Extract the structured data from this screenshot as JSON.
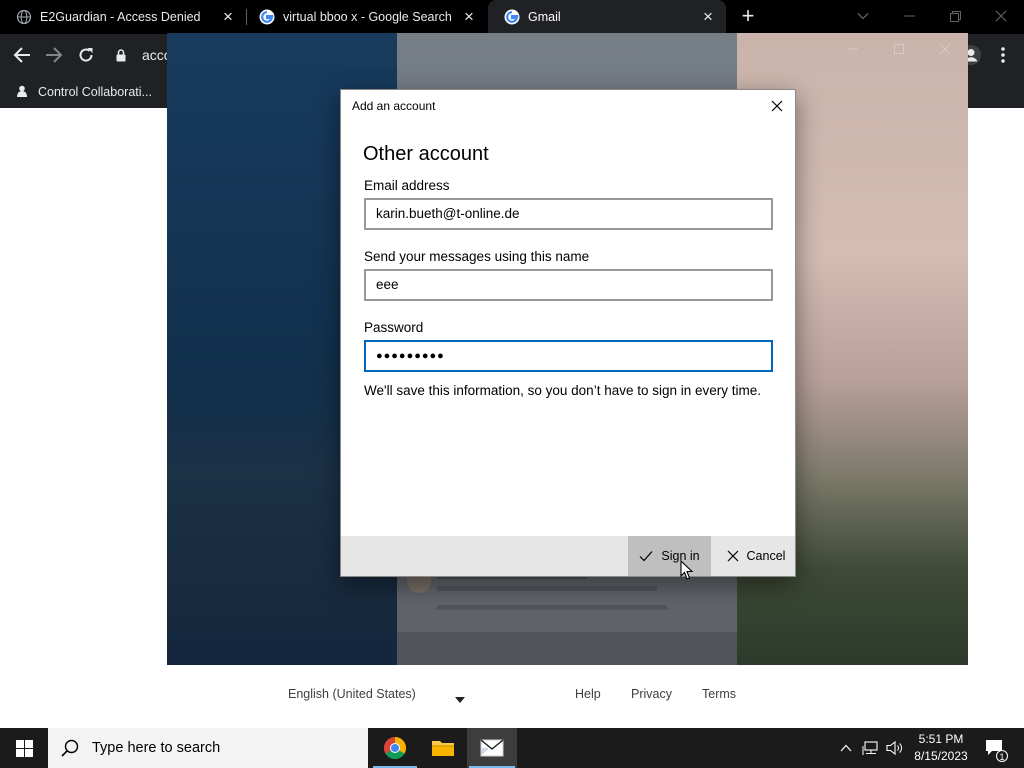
{
  "browser": {
    "tabs": [
      {
        "title": "E2Guardian - Access Denied",
        "favicon": "globe-icon",
        "active": false
      },
      {
        "title": "virtual bboo x - Google Search",
        "favicon": "google-icon",
        "active": false
      },
      {
        "title": "Gmail",
        "favicon": "google-icon",
        "active": true
      }
    ],
    "address_text": "acco",
    "bookmark_label": "Control Collaborati..."
  },
  "page": {
    "footer": {
      "language": "English (United States)",
      "help": "Help",
      "privacy": "Privacy",
      "terms": "Terms"
    }
  },
  "dialog": {
    "title": "Add an account",
    "heading": "Other account",
    "email_label": "Email address",
    "email_value": "karin.bueth@t-online.de",
    "name_label": "Send your messages using this name",
    "name_value": "eee",
    "password_label": "Password",
    "password_value": "●●●●●●●●●",
    "note": "We'll save this information, so you don’t have to sign in every time.",
    "signin_label": "Sign in",
    "cancel_label": "Cancel"
  },
  "taskbar": {
    "search_placeholder": "Type here to search",
    "time": "5:51 PM",
    "date": "8/15/2023",
    "notification_count": "1"
  },
  "colors": {
    "accent": "#0067c0",
    "chrome_dark": "#202124",
    "taskbar": "#1b1b1b"
  }
}
